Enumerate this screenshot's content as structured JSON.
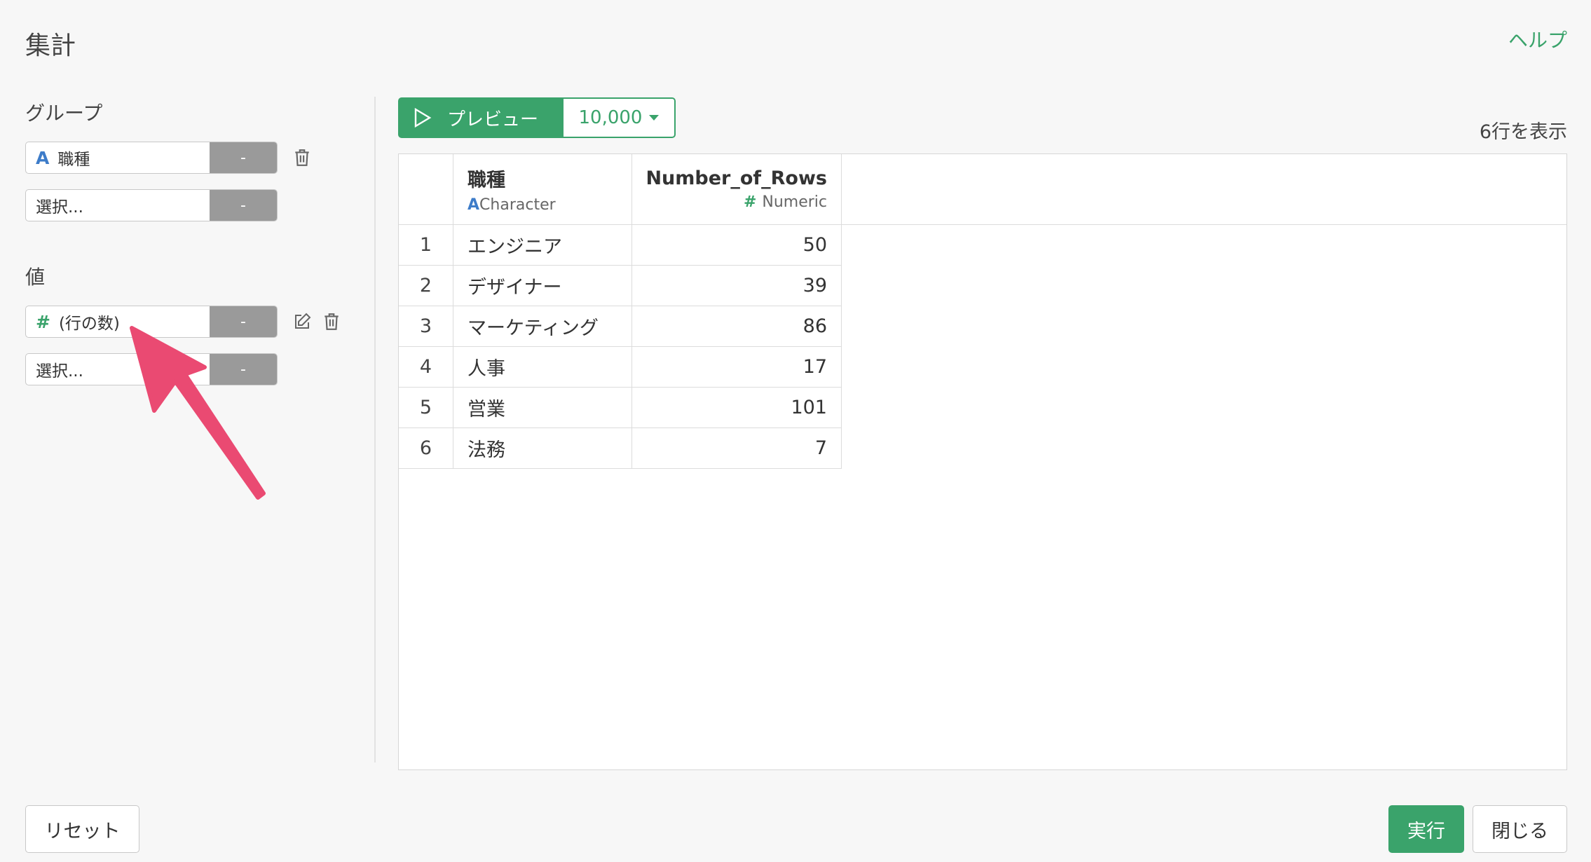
{
  "dialog": {
    "title": "集計",
    "help_label": "ヘルプ"
  },
  "group": {
    "label": "グループ",
    "items": [
      {
        "type_icon": "A",
        "value": "職種",
        "dash": "-"
      }
    ],
    "placeholder": "選択...",
    "placeholder_dash": "-"
  },
  "values": {
    "label": "値",
    "items": [
      {
        "type_icon": "#",
        "value": "(行の数)",
        "dash": "-"
      }
    ],
    "placeholder": "選択...",
    "placeholder_dash": "-"
  },
  "toolbar": {
    "preview_label": "プレビュー",
    "rows_limit": "10,000"
  },
  "row_count_label": "6行を表示",
  "table": {
    "columns": [
      {
        "name": "職種",
        "type_icon": "A",
        "type_label": "Character"
      },
      {
        "name": "Number_of_Rows",
        "type_icon": "#",
        "type_label": "Numeric"
      }
    ],
    "rows": [
      {
        "index": "1",
        "job": "エンジニア",
        "count": "50"
      },
      {
        "index": "2",
        "job": "デザイナー",
        "count": "39"
      },
      {
        "index": "3",
        "job": "マーケティング",
        "count": "86"
      },
      {
        "index": "4",
        "job": "人事",
        "count": "17"
      },
      {
        "index": "5",
        "job": "営業",
        "count": "101"
      },
      {
        "index": "6",
        "job": "法務",
        "count": "7"
      }
    ]
  },
  "footer": {
    "reset_label": "リセット",
    "run_label": "実行",
    "close_label": "閉じる"
  },
  "colors": {
    "accent": "#3aa36b",
    "annotation_arrow": "#ea4a72",
    "type_character": "#3d7cc9"
  }
}
